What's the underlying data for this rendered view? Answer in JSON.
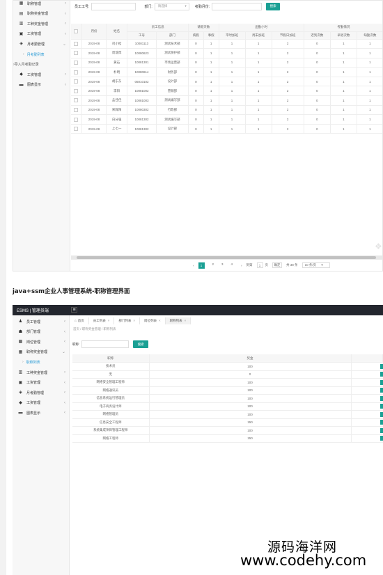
{
  "screen1": {
    "sidebar": {
      "items": [
        {
          "icon": "grid-icon",
          "label": "职称管理",
          "chevron": "‹"
        },
        {
          "icon": "chart-icon",
          "label": "职称奖金管理",
          "chevron": "‹"
        },
        {
          "icon": "bar-chart-icon",
          "label": "工种奖金管理",
          "chevron": "‹"
        },
        {
          "icon": "folder-icon",
          "label": "工资管理",
          "chevron": "‹"
        },
        {
          "icon": "layers-icon",
          "label": "月考勤管理",
          "chevron": "⌄"
        },
        {
          "icon": "",
          "label": "月考勤列表",
          "chevron": ""
        },
        {
          "icon": "",
          "label": "导入月考勤记录",
          "chevron": ""
        },
        {
          "icon": "tag-icon",
          "label": "工资管理",
          "chevron": "‹"
        },
        {
          "icon": "doc-icon",
          "label": "图表显示",
          "chevron": "‹"
        }
      ]
    },
    "filter": {
      "employee_no_label": "员工工号:",
      "dept_label": "部门:",
      "dept_value": "请选择",
      "month_label": "考勤月份:",
      "search_button": "搜索"
    },
    "table": {
      "group_headers": [
        "月份",
        "姓名",
        "员工信息",
        "请假天数",
        "出勤小时",
        "考勤情况"
      ],
      "sub_headers": [
        "工号",
        "部门",
        "病假",
        "事假",
        "平时加班",
        "周末加班",
        "节假日加班",
        "迟到次数",
        "早退次数",
        "缺勤次数"
      ],
      "rows": [
        [
          "2019-08",
          "司小松",
          "10081113",
          "测试技术部",
          "0",
          "1",
          "1",
          "1",
          "2",
          "0",
          "1",
          "1"
        ],
        [
          "2019-08",
          "周瑞萍",
          "10080623",
          "测试保护部",
          "0",
          "1",
          "1",
          "1",
          "2",
          "0",
          "1",
          "1"
        ],
        [
          "2019-08",
          "黄石",
          "10081301",
          "市场运营部",
          "0",
          "1",
          "1",
          "1",
          "2",
          "0",
          "1",
          "1"
        ],
        [
          "2019-08",
          "朴明",
          "10080614",
          "财务部",
          "0",
          "1",
          "1",
          "1",
          "2",
          "0",
          "1",
          "1"
        ],
        [
          "2019-08",
          "胡东东",
          "05010102",
          "设计部",
          "0",
          "1",
          "1",
          "1",
          "2",
          "0",
          "1",
          "1"
        ],
        [
          "2019-08",
          "李阳",
          "10081002",
          "营销部",
          "0",
          "1",
          "1",
          "1",
          "2",
          "0",
          "1",
          "1"
        ],
        [
          "2019-08",
          "孟佳佳",
          "10081003",
          "测试编写部",
          "0",
          "1",
          "1",
          "1",
          "2",
          "0",
          "1",
          "1"
        ],
        [
          "2019-08",
          "宋辉阳",
          "10080302",
          "行政部",
          "0",
          "1",
          "1",
          "1",
          "2",
          "0",
          "1",
          "1"
        ],
        [
          "2019-08",
          "白分强",
          "10081302",
          "测试编写部",
          "0",
          "1",
          "1",
          "1",
          "2",
          "0",
          "1",
          "1"
        ],
        [
          "2019-08",
          "上七一",
          "10081302",
          "设计部",
          "0",
          "1",
          "1",
          "1",
          "2",
          "0",
          "1",
          "1"
        ]
      ]
    },
    "pager": {
      "prev": "‹",
      "pages": [
        "1",
        "2",
        "3",
        "4"
      ],
      "current": "1",
      "next": "›",
      "goto_label": "到第",
      "goto_value": "1",
      "page_unit": "页",
      "confirm": "确定",
      "total": "共 38 条",
      "per_page": "10 条/页"
    }
  },
  "caption": "java+ssm企业人事管理系统-职称管理界面",
  "screen2": {
    "brand": "ESMS | 管理员端",
    "hamburger": "≡",
    "sidebar": {
      "items": [
        {
          "icon": "user-icon",
          "label": "员工管理",
          "chevron": "‹"
        },
        {
          "icon": "sitemap-icon",
          "label": "部门管理",
          "chevron": "‹"
        },
        {
          "icon": "briefcase-icon",
          "label": "岗位管理",
          "chevron": "‹"
        },
        {
          "icon": "grid-icon",
          "label": "职称奖金管理",
          "chevron": "⌄"
        },
        {
          "icon": "",
          "label": "职称列表",
          "chevron": ""
        },
        {
          "icon": "bar-chart-icon",
          "label": "工种奖金管理",
          "chevron": "‹"
        },
        {
          "icon": "folder-icon",
          "label": "工资管理",
          "chevron": "‹"
        },
        {
          "icon": "layers-icon",
          "label": "月考勤管理",
          "chevron": "‹"
        },
        {
          "icon": "tag-icon",
          "label": "工资管理",
          "chevron": "‹"
        },
        {
          "icon": "doc-icon",
          "label": "图表显示",
          "chevron": "‹"
        }
      ]
    },
    "tabs": [
      {
        "label": "首页",
        "active": false,
        "closable": false
      },
      {
        "label": "员工列表",
        "active": false,
        "closable": true
      },
      {
        "label": "部门列表",
        "active": false,
        "closable": true
      },
      {
        "label": "岗位列表",
        "active": false,
        "closable": true
      },
      {
        "label": "职称列表",
        "active": true,
        "closable": true
      }
    ],
    "breadcrumb": "首页 / 职称奖金管理 / 职称列表",
    "search": {
      "label": "职称:",
      "button": "搜索"
    },
    "table": {
      "headers": [
        "职称",
        "奖金"
      ],
      "rows": [
        [
          "技术员",
          "100"
        ],
        [
          "无",
          "0"
        ],
        [
          "网络安全管理工程师",
          "100"
        ],
        [
          "网络通讯员",
          "100"
        ],
        [
          "信息系统运行管理员",
          "100"
        ],
        [
          "电子商务设计师",
          "100"
        ],
        [
          "网络管理员",
          "100"
        ],
        [
          "信息安全工程师",
          "150"
        ],
        [
          "系统集成项目管理工程师",
          "100"
        ],
        [
          "网络工程师",
          "150"
        ]
      ]
    }
  },
  "watermark": {
    "line1": "源码海洋网",
    "line2": "www.codehy.com"
  }
}
